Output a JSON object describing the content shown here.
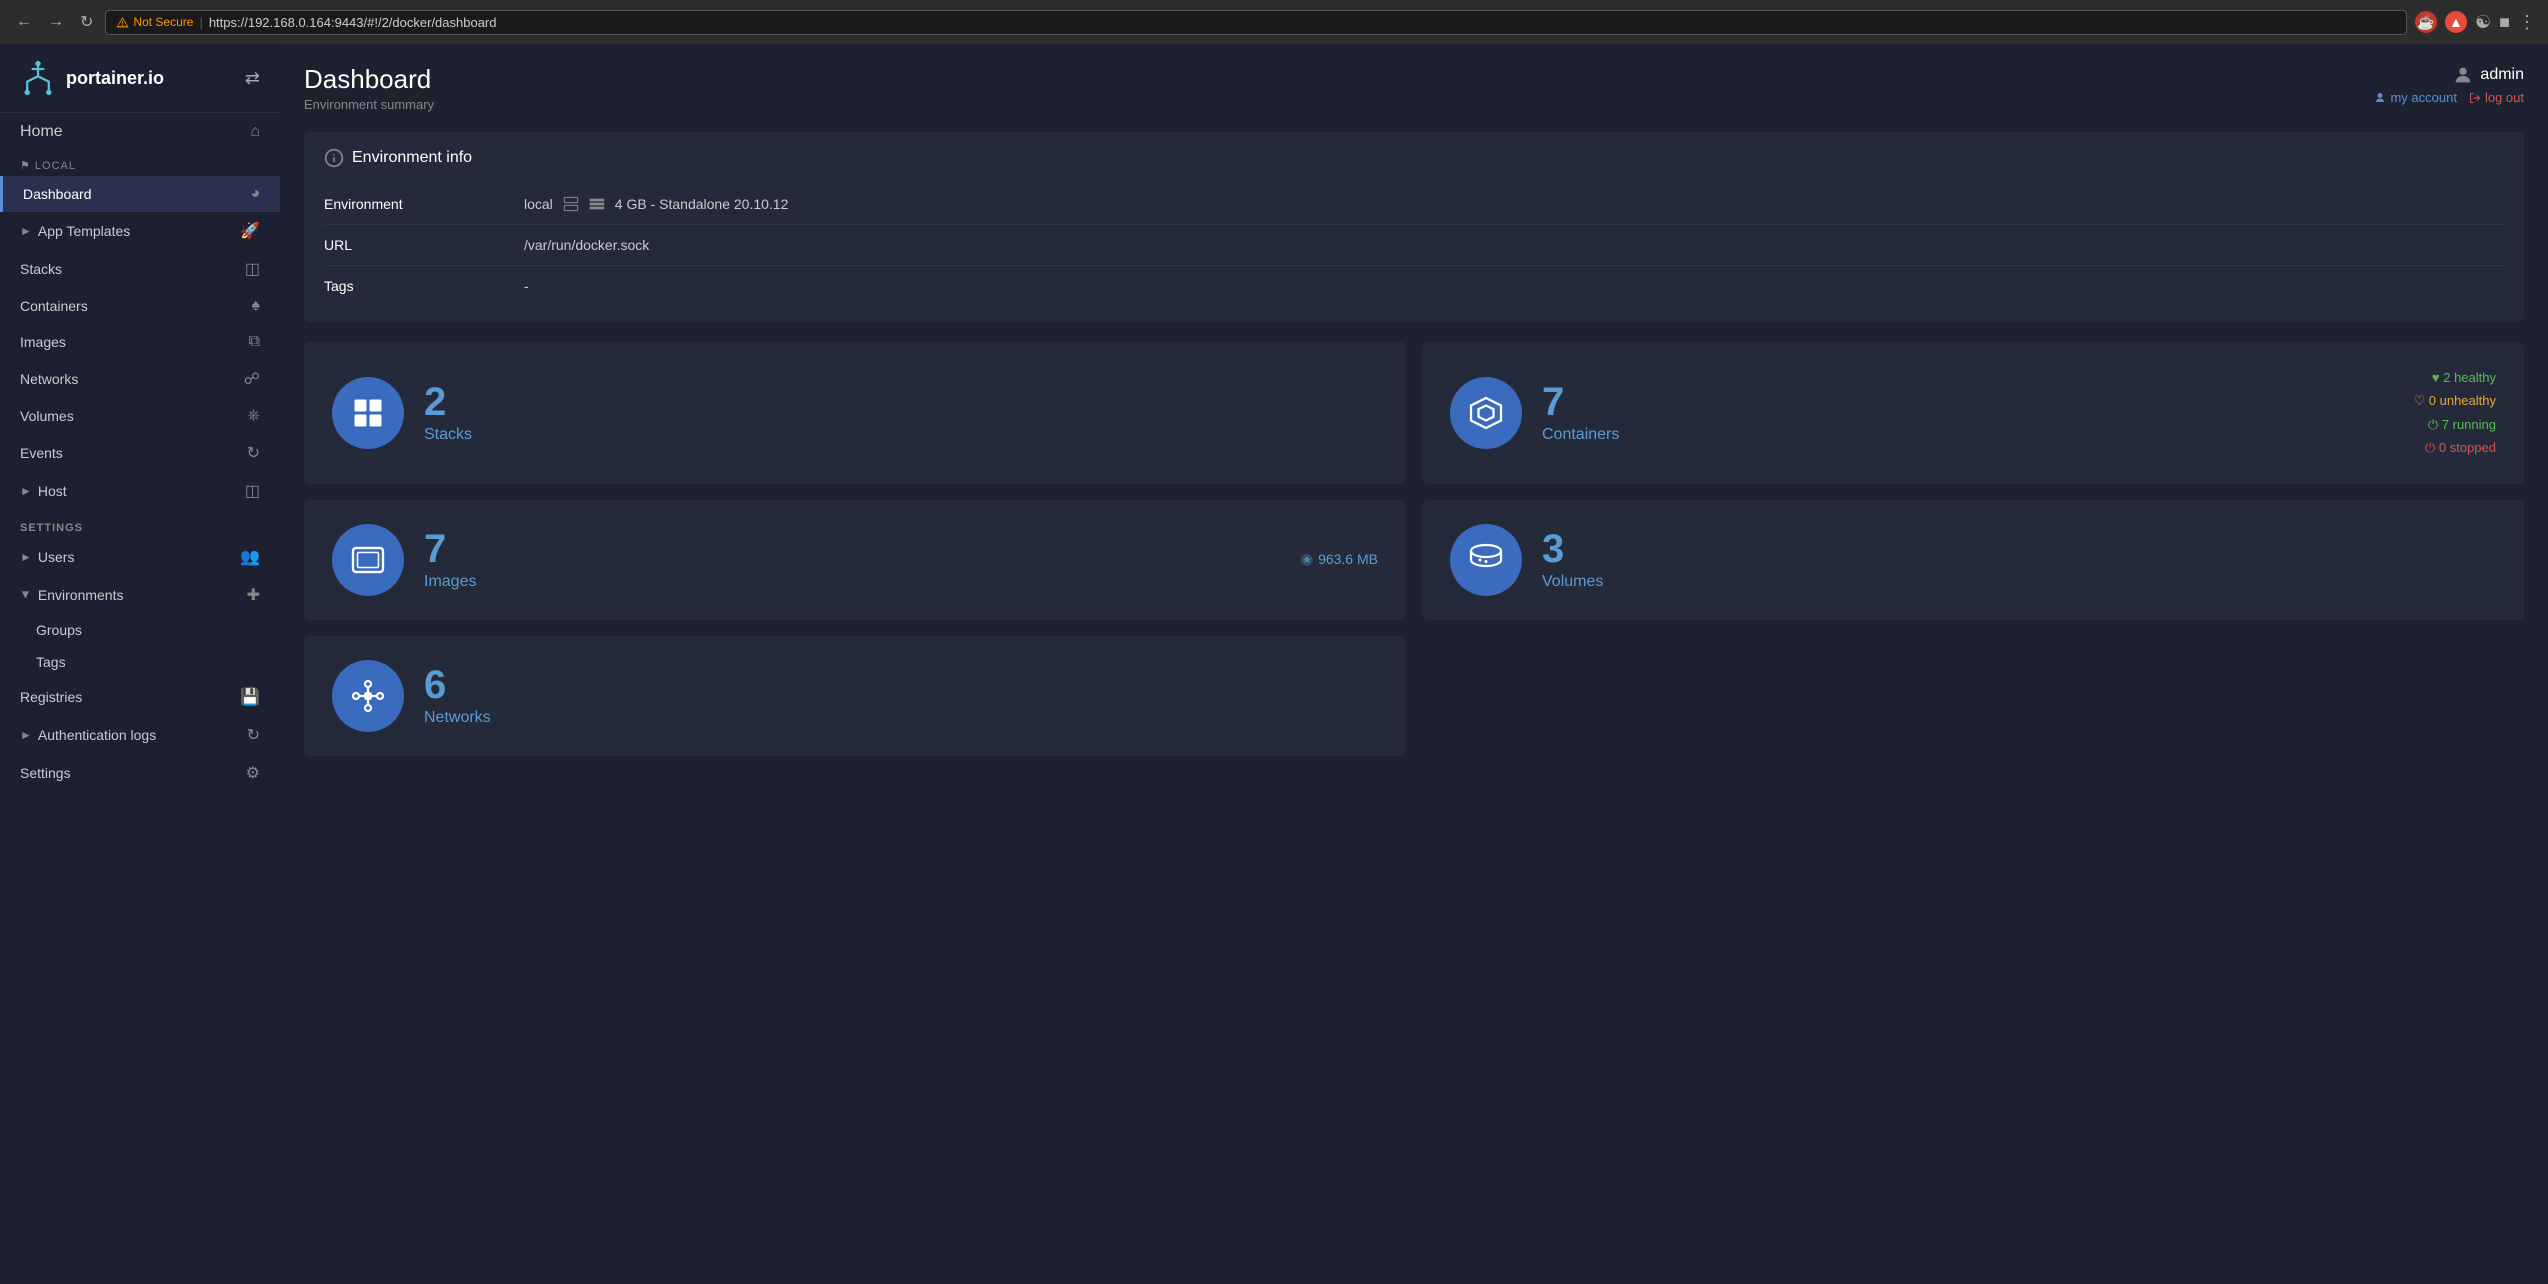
{
  "browser": {
    "not_secure_label": "Not Secure",
    "url": "https://192.168.0.164:9443/#!/2/docker/dashboard",
    "nav_back": "←",
    "nav_forward": "→",
    "nav_reload": "↺"
  },
  "sidebar": {
    "logo_text": "portainer.io",
    "home_label": "Home",
    "local_label": "⚑ LOCAL",
    "items": [
      {
        "label": "Dashboard",
        "active": true
      },
      {
        "label": "App Templates",
        "has_arrow": true
      },
      {
        "label": "Stacks"
      },
      {
        "label": "Containers"
      },
      {
        "label": "Images"
      },
      {
        "label": "Networks"
      },
      {
        "label": "Volumes"
      },
      {
        "label": "Events"
      },
      {
        "label": "Host",
        "has_arrow": true
      }
    ],
    "settings_label": "SETTINGS",
    "settings_items": [
      {
        "label": "Users",
        "has_arrow": true
      },
      {
        "label": "Environments",
        "expanded": true
      },
      {
        "label": "Groups",
        "sub": true
      },
      {
        "label": "Tags",
        "sub": true
      },
      {
        "label": "Registries"
      },
      {
        "label": "Authentication logs",
        "has_arrow": true
      },
      {
        "label": "Settings"
      }
    ]
  },
  "header": {
    "title": "Dashboard",
    "subtitle": "Environment summary",
    "user": {
      "name": "admin",
      "my_account": "my account",
      "log_out": "log out"
    }
  },
  "environment_info": {
    "section_title": "Environment info",
    "rows": [
      {
        "label": "Environment",
        "value": "local",
        "extra": "4 GB - Standalone 20.10.12"
      },
      {
        "label": "URL",
        "value": "/var/run/docker.sock"
      },
      {
        "label": "Tags",
        "value": "-"
      }
    ]
  },
  "stats": [
    {
      "id": "stacks",
      "number": "2",
      "label": "Stacks",
      "icon": "stacks"
    },
    {
      "id": "containers",
      "number": "7",
      "label": "Containers",
      "icon": "containers",
      "extras": [
        {
          "text": "2 healthy",
          "class": "healthy",
          "prefix": "♥"
        },
        {
          "text": "7 running",
          "class": "running",
          "prefix": "⏻"
        },
        {
          "text": "0 unhealthy",
          "class": "unhealthy",
          "prefix": "♥"
        },
        {
          "text": "0 stopped",
          "class": "stopped",
          "prefix": "⏻"
        }
      ]
    },
    {
      "id": "images",
      "number": "7",
      "label": "Images",
      "icon": "images",
      "size": "963.6 MB"
    },
    {
      "id": "volumes",
      "number": "3",
      "label": "Volumes",
      "icon": "volumes"
    },
    {
      "id": "networks",
      "number": "6",
      "label": "Networks",
      "icon": "networks"
    }
  ],
  "colors": {
    "accent": "#5b9bd5",
    "sidebar_bg": "#1c2030",
    "card_bg": "#252a3a",
    "active_border": "#5b8dd9",
    "healthy": "#5cb85c",
    "unhealthy": "#e8a838",
    "running": "#5cb85c",
    "stopped": "#d9534f"
  }
}
